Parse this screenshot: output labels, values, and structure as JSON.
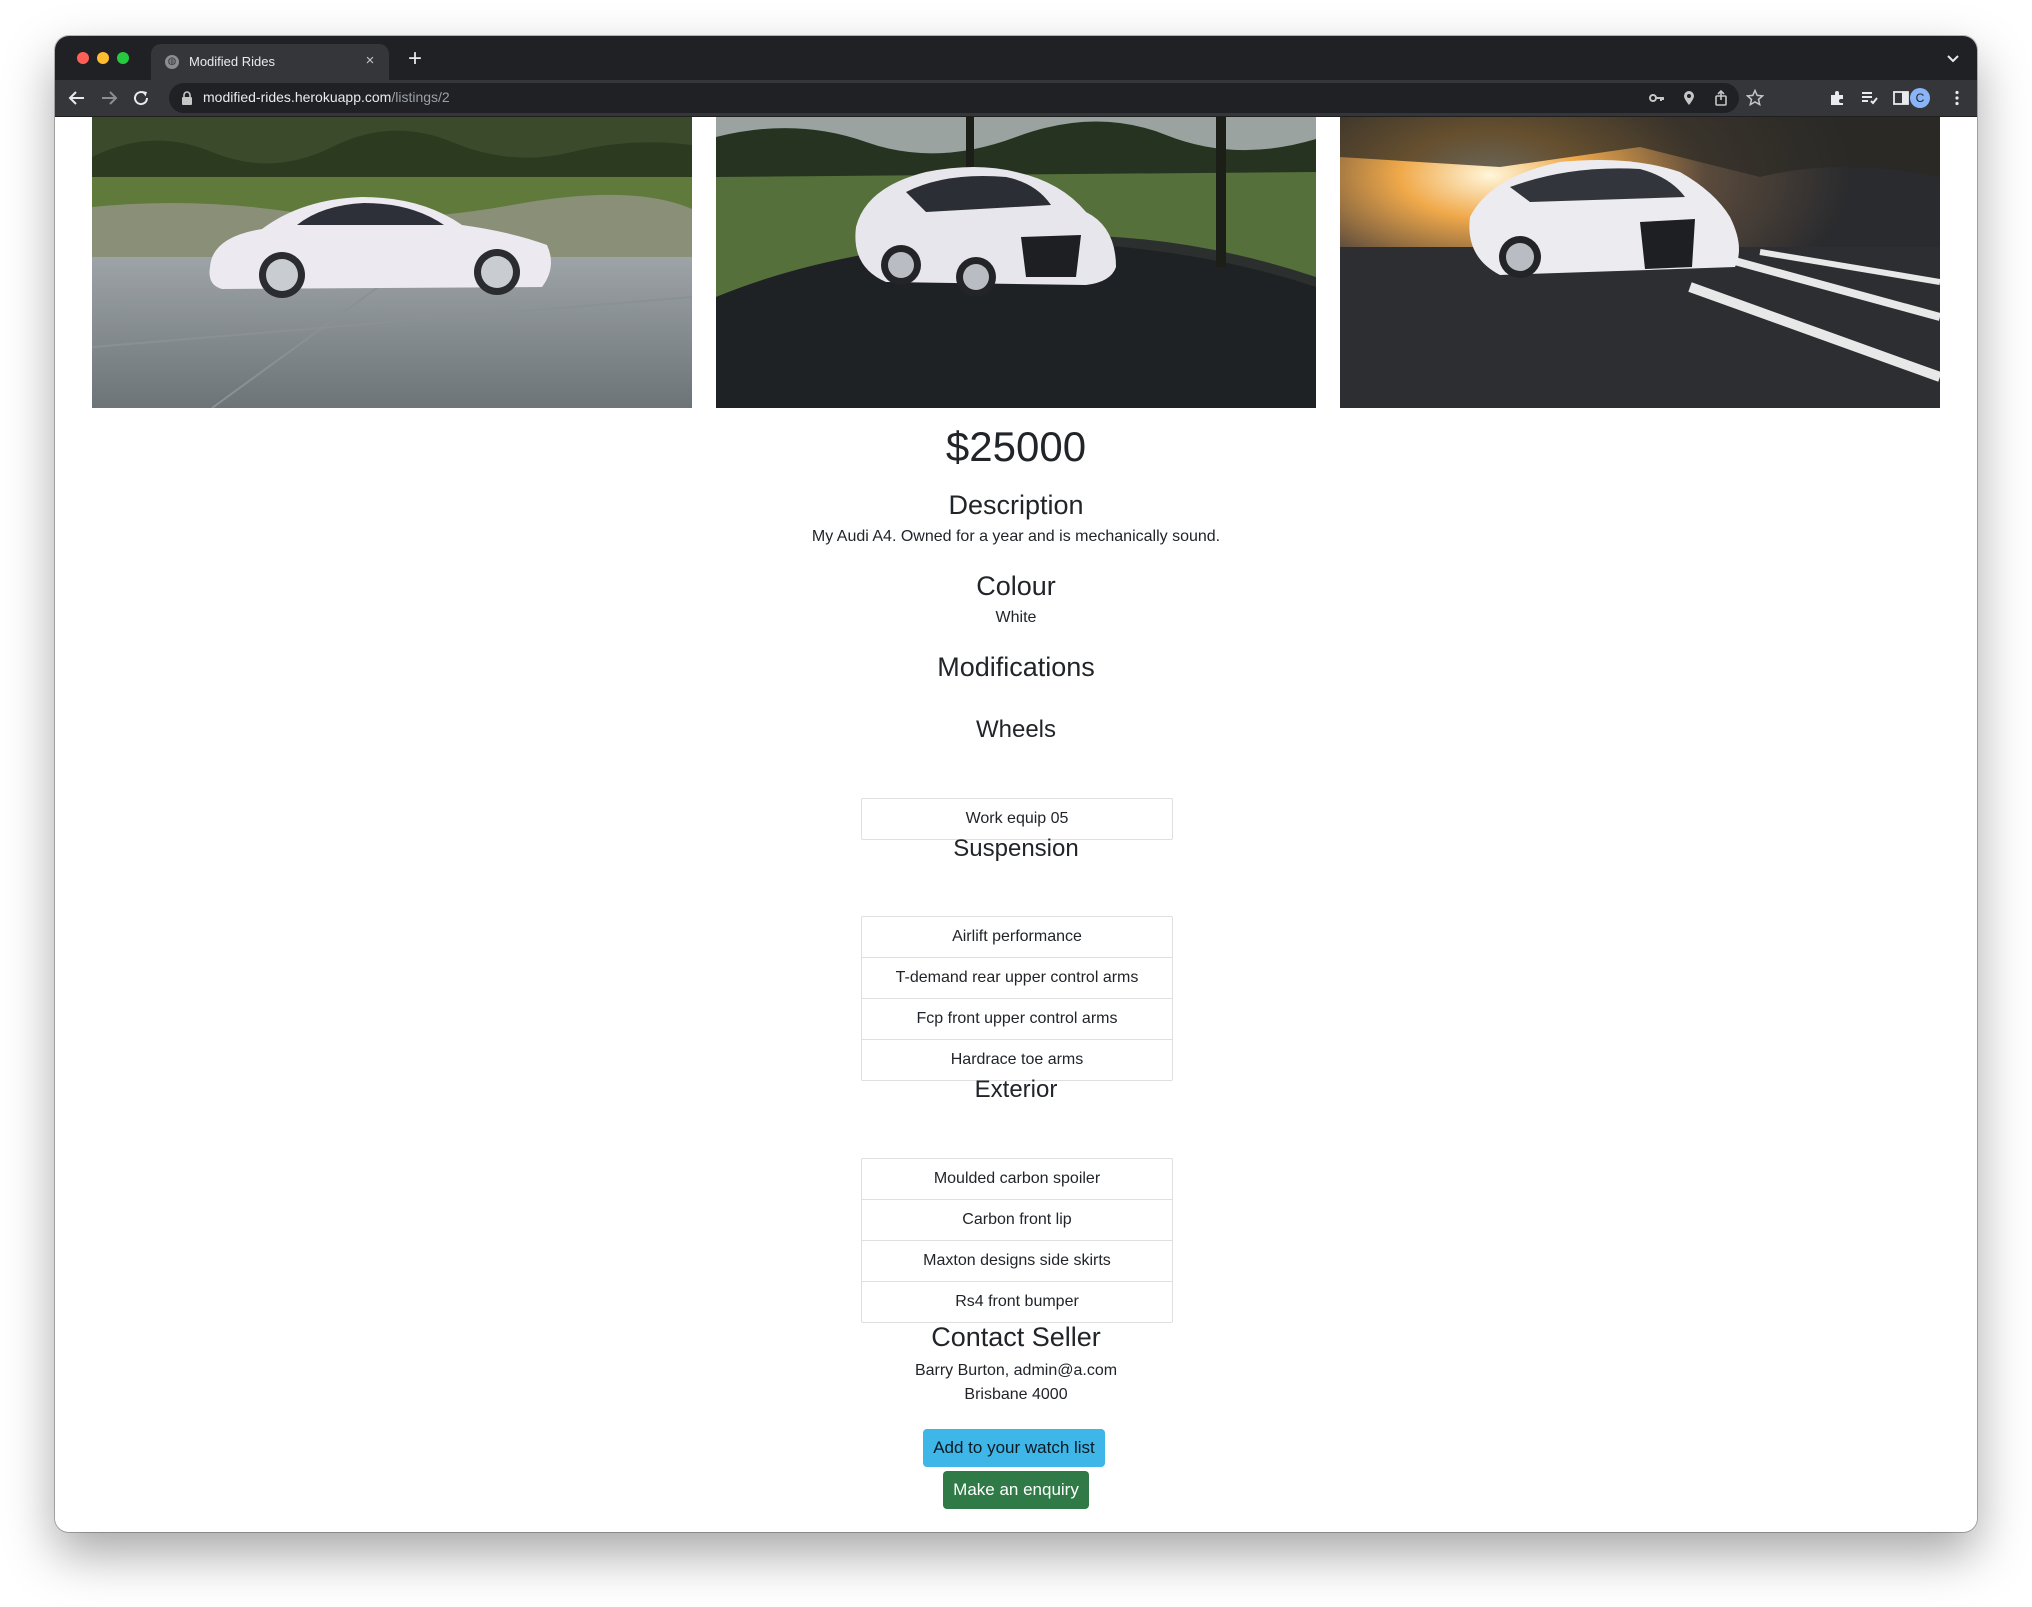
{
  "browser": {
    "tab_title": "Modified Rides",
    "tab_close_glyph": "×",
    "new_tab_glyph": "+",
    "favicon_glyph": "◍",
    "url_host": "modified-rides.herokuapp.com",
    "url_path": "/listings/2",
    "avatar_initial": "C",
    "icons": [
      "back-arrow-icon",
      "forward-arrow-icon",
      "reload-icon",
      "lock-icon",
      "key-icon",
      "location-pin-icon",
      "share-icon",
      "star-icon",
      "extensions-puzzle-icon",
      "reading-list-icon",
      "side-panel-icon",
      "kebab-menu-icon",
      "tab-search-chevron-icon"
    ]
  },
  "listing": {
    "photos": [
      "audi-side-view-photo",
      "audi-front-three-quarter-photo",
      "audi-sunset-front-photo"
    ],
    "price": "$25000",
    "description_heading": "Description",
    "description": "My Audi A4. Owned for a year and is mechanically sound.",
    "colour_heading": "Colour",
    "colour": "White",
    "modifications_heading": "Modifications",
    "wheels": {
      "heading": "Wheels",
      "items": [
        "Work equip 05"
      ]
    },
    "suspension": {
      "heading": "Suspension",
      "items": [
        "Airlift performance",
        "T-demand rear upper control arms",
        "Fcp front upper control arms",
        "Hardrace toe arms"
      ]
    },
    "exterior": {
      "heading": "Exterior",
      "items": [
        "Moulded carbon spoiler",
        "Carbon front lip",
        "Maxton designs side skirts",
        "Rs4 front bumper"
      ]
    },
    "contact_heading": "Contact Seller",
    "seller_line": "Barry Burton, admin@a.com",
    "seller_location": "Brisbane 4000",
    "watch_button": "Add to your watch list",
    "enquiry_button": "Make an enquiry"
  },
  "colors": {
    "watch_button_bg": "#3fb6e8",
    "enquiry_button_bg": "#2f7a46",
    "browser_chrome": "#202124"
  }
}
